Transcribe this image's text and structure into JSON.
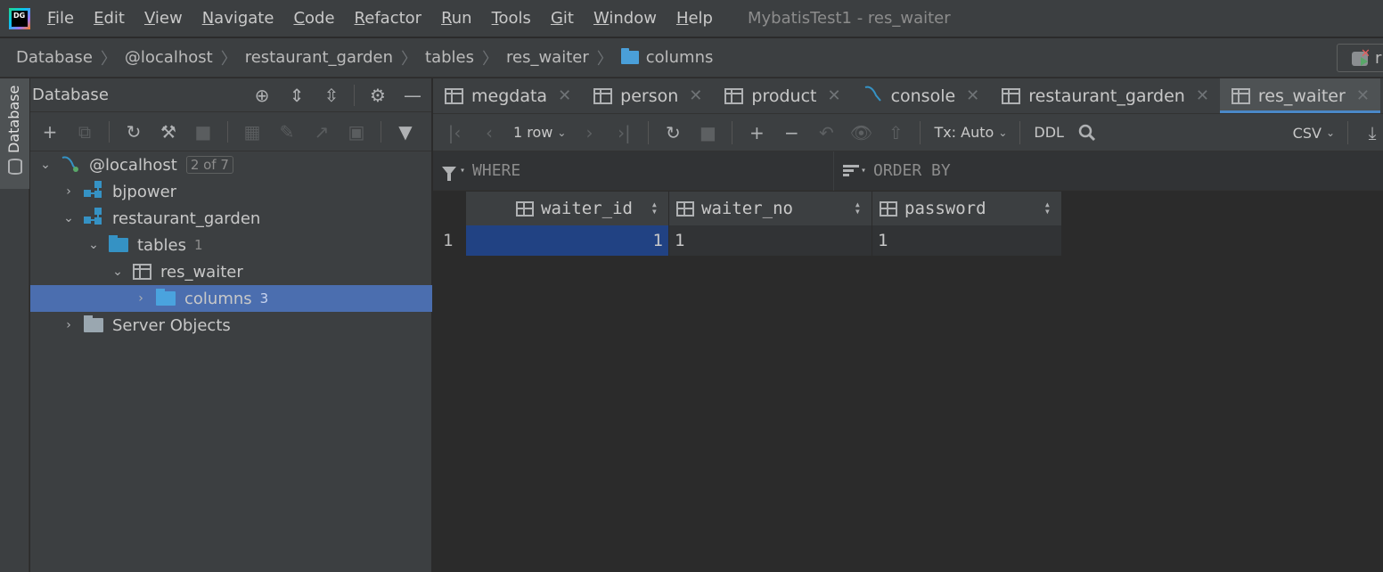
{
  "menu": {
    "items": [
      {
        "label": "File",
        "u": "F",
        "rest": "ile"
      },
      {
        "label": "Edit",
        "u": "E",
        "rest": "dit"
      },
      {
        "label": "View",
        "u": "V",
        "rest": "iew"
      },
      {
        "label": "Navigate",
        "u": "N",
        "rest": "avigate"
      },
      {
        "label": "Code",
        "u": "C",
        "rest": "ode"
      },
      {
        "label": "Refactor",
        "u": "R",
        "rest": "efactor"
      },
      {
        "label": "Run",
        "u": "R",
        "rest": "un"
      },
      {
        "label": "Tools",
        "u": "T",
        "rest": "ools"
      },
      {
        "label": "Git",
        "u": "G",
        "rest": "it"
      },
      {
        "label": "Window",
        "u": "W",
        "rest": "indow"
      },
      {
        "label": "Help",
        "u": "H",
        "rest": "elp"
      }
    ],
    "window_title": "MybatisTest1 - res_waiter",
    "logo_text": "DG"
  },
  "breadcrumb": {
    "items": [
      "Database",
      "@localhost",
      "restaurant_garden",
      "tables",
      "res_waiter",
      "columns"
    ],
    "run_config_label": "r"
  },
  "left_stripe": {
    "tab_label": "Database"
  },
  "db_panel": {
    "title": "Database",
    "tree": {
      "localhost": {
        "label": "@localhost",
        "badge": "2 of 7"
      },
      "bjpower": {
        "label": "bjpower"
      },
      "restaurant_garden": {
        "label": "restaurant_garden"
      },
      "tables": {
        "label": "tables",
        "count": "1"
      },
      "res_waiter": {
        "label": "res_waiter"
      },
      "columns": {
        "label": "columns",
        "count": "3"
      },
      "server_objects": {
        "label": "Server Objects"
      }
    }
  },
  "editor": {
    "tabs": [
      {
        "label": "megdata",
        "icon": "table-icon"
      },
      {
        "label": "person",
        "icon": "table-icon"
      },
      {
        "label": "product",
        "icon": "table-icon"
      },
      {
        "label": "console",
        "icon": "mysql-console-icon"
      },
      {
        "label": "restaurant_garden",
        "icon": "table-icon"
      },
      {
        "label": "res_waiter",
        "icon": "table-icon",
        "active": true
      }
    ],
    "toolbar": {
      "row_count": "1 row",
      "tx_mode": "Tx: Auto",
      "ddl": "DDL",
      "export_format": "CSV"
    },
    "filter": {
      "where_placeholder": "WHERE",
      "order_placeholder": "ORDER BY"
    },
    "grid": {
      "columns": [
        "waiter_id",
        "waiter_no",
        "password"
      ],
      "rows": [
        {
          "num": "1",
          "cells": [
            "1",
            "1",
            "1"
          ]
        }
      ]
    }
  },
  "colors": {
    "selection": "#4b6eaf",
    "active_tab_underline": "#4a88c7",
    "cell_selected": "#214283",
    "schema_icon": "#3592c4"
  }
}
